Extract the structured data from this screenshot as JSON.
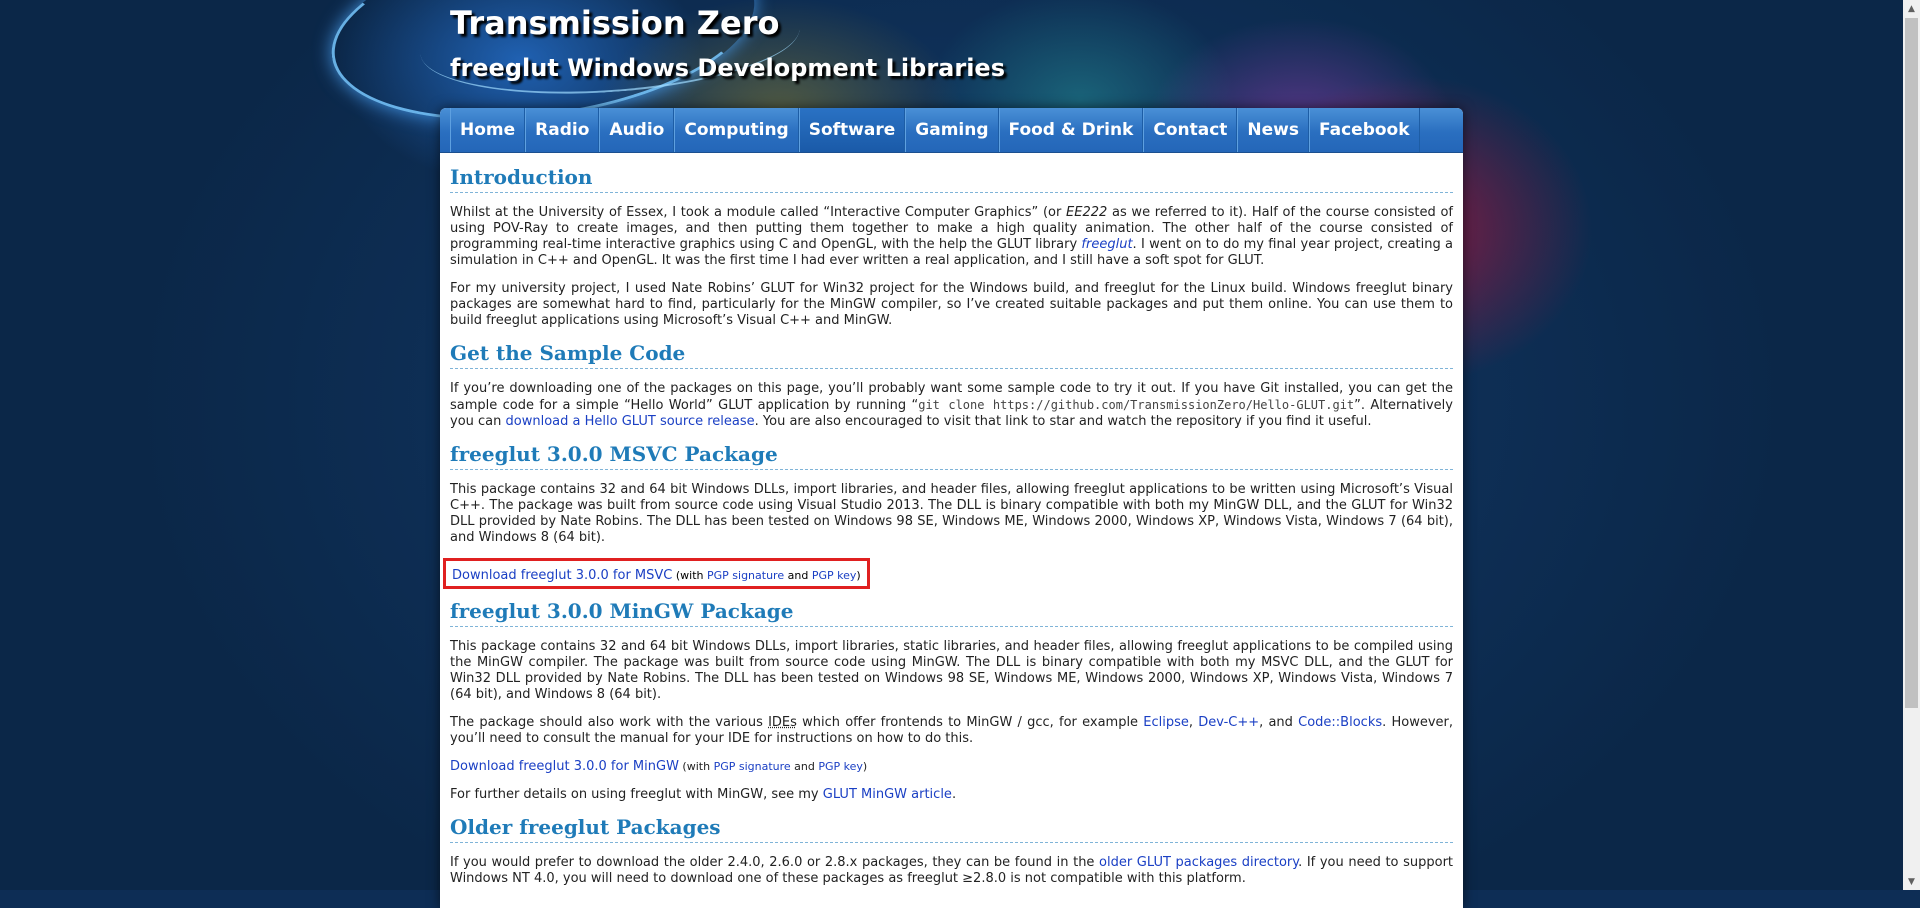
{
  "header": {
    "title": "Transmission Zero",
    "subtitle": "freeglut Windows Development Libraries"
  },
  "nav": {
    "items": [
      "Home",
      "Radio",
      "Audio",
      "Computing",
      "Software",
      "Gaming",
      "Food & Drink",
      "Contact",
      "News",
      "Facebook"
    ],
    "active": "Software"
  },
  "intro": {
    "heading": "Introduction",
    "p1_a": "Whilst at the University of Essex, I took a module called “Interactive Computer Graphics” (or ",
    "p1_em": "EE222",
    "p1_b": " as we referred to it). Half of the course consisted of using POV-Ray to create images, and then putting them together to make a high quality animation. The other half of the course consisted of programming real-time interactive graphics using C and OpenGL, with the help the GLUT library ",
    "p1_link": "freeglut",
    "p1_c": ". I went on to do my final year project, creating a simulation in C++ and OpenGL. It was the first time I had ever written a real application, and I still have a soft spot for GLUT.",
    "p2": "For my university project, I used Nate Robins’ GLUT for Win32 project for the Windows build, and freeglut for the Linux build. Windows freeglut binary packages are somewhat hard to find, particularly for the MinGW compiler, so I’ve created suitable packages and put them online. You can use them to build freeglut applications using Microsoft’s Visual C++ and MinGW."
  },
  "sample": {
    "heading": "Get the Sample Code",
    "a": "If you’re downloading one of the packages on this page, you’ll probably want some sample code to try it out. If you have Git installed, you can get the sample code for a simple “Hello World” GLUT application by running “",
    "code": "git clone https://github.com/TransmissionZero/Hello-GLUT.git",
    "b": "”. Alternatively you can ",
    "link": "download a Hello GLUT source release",
    "c": ". You are also encouraged to visit that link to star and watch the repository if you find it useful."
  },
  "msvc": {
    "heading": "freeglut 3.0.0 MSVC Package",
    "text": "This package contains 32 and 64 bit Windows DLLs, import libraries, and header files, allowing freeglut applications to be written using Microsoft’s Visual C++. The package was built from source code using Visual Studio 2013. The DLL is binary compatible with both my MinGW DLL, and the GLUT for Win32 DLL provided by Nate Robins. The DLL has been tested on Windows 98 SE, Windows ME, Windows 2000, Windows XP, Windows Vista, Windows 7 (64 bit), and Windows 8 (64 bit).",
    "download": "Download freeglut 3.0.0 for MSVC",
    "with": " (with ",
    "sig": "PGP signature",
    "and": " and ",
    "key": "PGP key",
    "close": ")"
  },
  "mingw": {
    "heading": "freeglut 3.0.0 MinGW Package",
    "text": "This package contains 32 and 64 bit Windows DLLs, import libraries, static libraries, and header files, allowing freeglut applications to be compiled using the MinGW compiler. The package was built from source code using MinGW. The DLL is binary compatible with both my MSVC DLL, and the GLUT for Win32 DLL provided by Nate Robins. The DLL has been tested on Windows 98 SE, Windows ME, Windows 2000, Windows XP, Windows Vista, Windows 7 (64 bit), and Windows 8 (64 bit).",
    "ide_a": "The package should also work with the various ",
    "ide_abbr": "IDEs",
    "ide_b": " which offer frontends to MinGW / gcc, for example ",
    "eclipse": "Eclipse",
    "comma": ", ",
    "devcpp": "Dev-C++",
    "and_text": ", and ",
    "codeblocks": "Code::Blocks",
    "ide_c": ". However, you’ll need to consult the manual for your IDE for instructions on how to do this.",
    "download": "Download freeglut 3.0.0 for MinGW",
    "with": " (with ",
    "sig": "PGP signature",
    "and": " and ",
    "key": "PGP key",
    "close": ")",
    "further_a": "For further details on using freeglut with MinGW, see my ",
    "further_link": "GLUT MinGW article",
    "further_b": "."
  },
  "older": {
    "heading": "Older freeglut Packages",
    "a": "If you would prefer to download the older 2.4.0, 2.6.0 or 2.8.x packages, they can be found in the ",
    "link": "older GLUT packages directory",
    "b": ". If you need to support Windows NT 4.0, you will need to download one of these packages as freeglut ≥2.8.0 is not compatible with this platform."
  },
  "colors": {
    "heading": "#1f7bb8",
    "link": "#1a3fc4",
    "nav": "#2a6fc0",
    "highlight": "#e02020"
  }
}
